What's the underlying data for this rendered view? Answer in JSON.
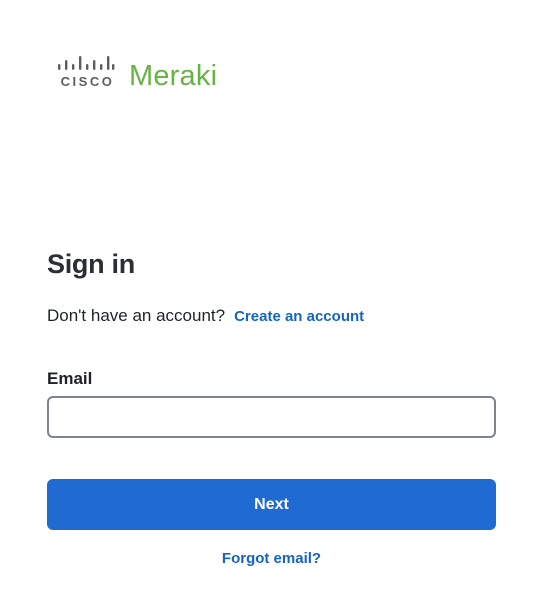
{
  "brand": {
    "cisco_text": "CISCO",
    "product_text": "Meraki",
    "cisco_color": "#5b5f63",
    "product_color": "#67b346"
  },
  "signin": {
    "title": "Sign in",
    "no_account_text": "Don't have an account?",
    "create_account_link": "Create an account",
    "email_label": "Email",
    "email_value": "",
    "email_placeholder": "",
    "next_button": "Next",
    "forgot_email_link": "Forgot email?"
  },
  "colors": {
    "primary": "#1f6bd1",
    "link": "#1565c0",
    "input_border": "#7d858c"
  }
}
